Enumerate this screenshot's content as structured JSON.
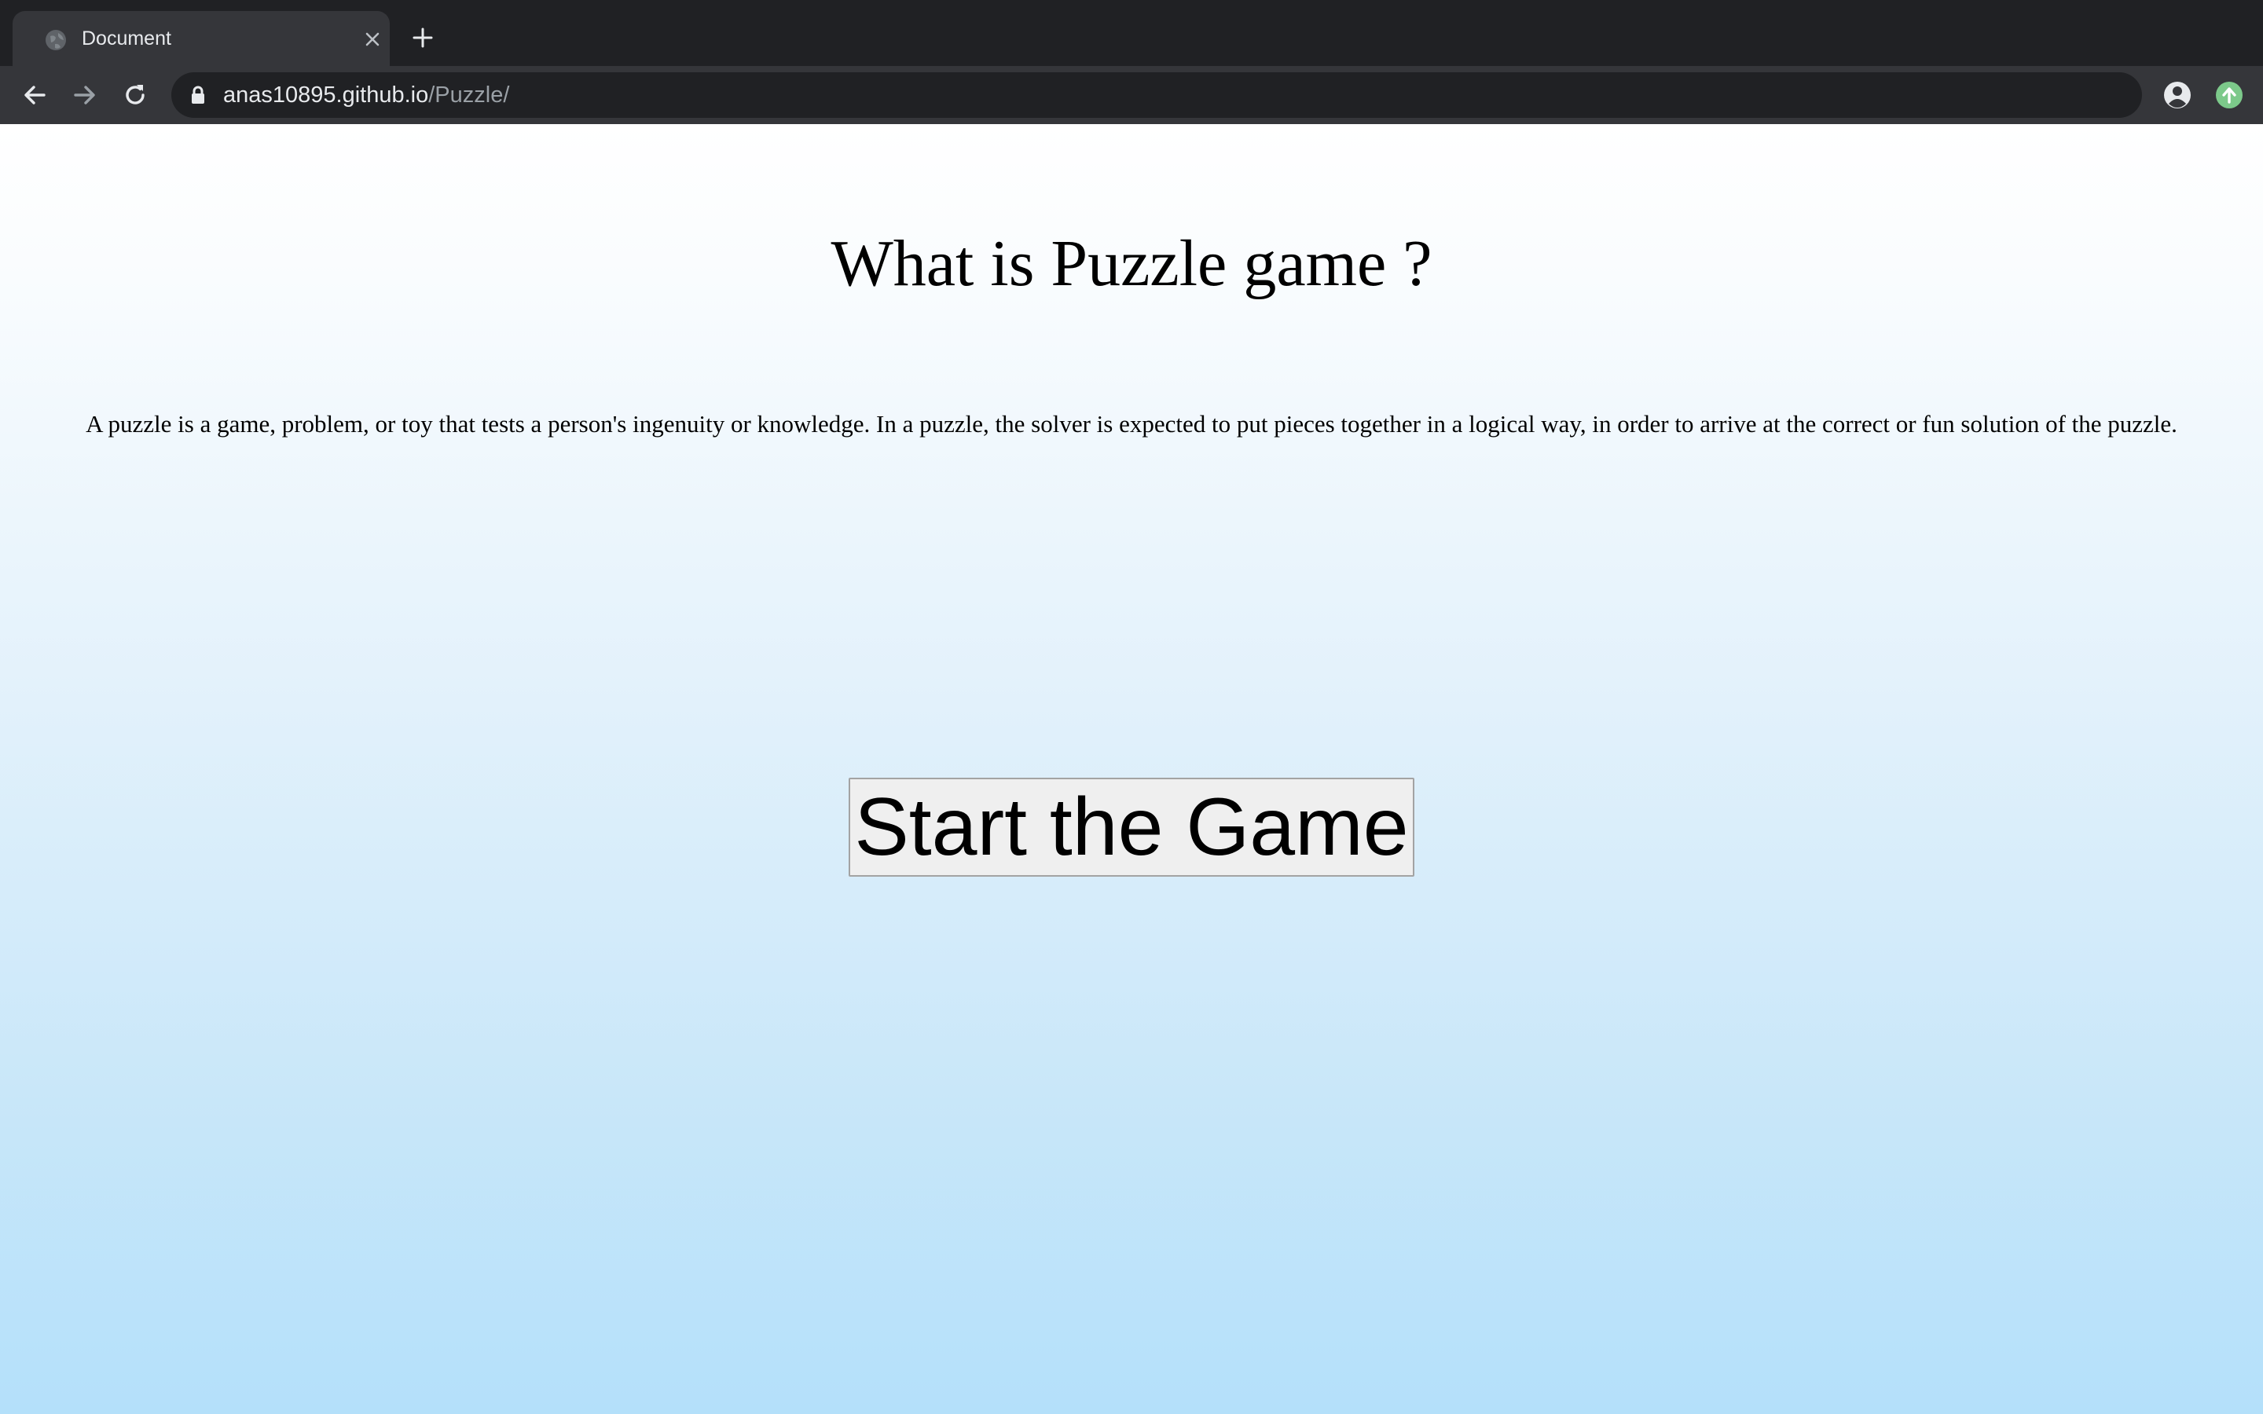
{
  "browser": {
    "tab": {
      "title": "Document"
    },
    "address_bar": {
      "host": "anas10895.github.io",
      "path": "/Puzzle/"
    }
  },
  "page": {
    "heading": "What is Puzzle game ?",
    "description": "A puzzle is a game, problem, or toy that tests a person's ingenuity or knowledge. In a puzzle, the solver is expected to put pieces together in a logical way, in order to arrive at the correct or fun solution of the puzzle.",
    "start_button_label": "Start the Game"
  },
  "icons": {
    "tab_favicon": "globe-icon",
    "tab_close": "close-icon",
    "new_tab": "plus-icon",
    "back": "arrow-left-icon",
    "forward": "arrow-right-icon",
    "reload": "reload-icon",
    "secure": "lock-icon",
    "bookmark": "star-icon",
    "profile": "account-circle-icon",
    "extension": "upload-circle-icon"
  },
  "colors": {
    "chrome_dark": "#202124",
    "chrome_toolbar": "#35363a",
    "page_gradient_top": "#ffffff",
    "page_gradient_bottom": "#b4e0fa",
    "extension_accent": "#7cc98a"
  }
}
